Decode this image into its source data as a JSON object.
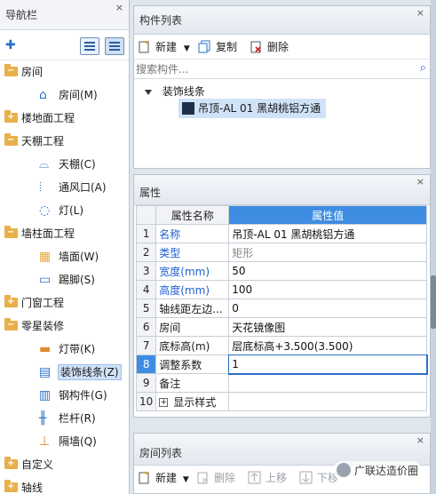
{
  "nav": {
    "title": "导航栏",
    "items": [
      {
        "label": "房间",
        "type": "group",
        "toggle": "−"
      },
      {
        "label": "房间(M)",
        "type": "sub",
        "icon": "house-icon"
      },
      {
        "label": "楼地面工程",
        "type": "group",
        "toggle": "+"
      },
      {
        "label": "天棚工程",
        "type": "group",
        "toggle": "−"
      },
      {
        "label": "天棚(C)",
        "type": "sub",
        "icon": "ceiling-icon"
      },
      {
        "label": "通风口(A)",
        "type": "sub",
        "icon": "vent-icon"
      },
      {
        "label": "灯(L)",
        "type": "sub",
        "icon": "bulb-icon"
      },
      {
        "label": "墙柱面工程",
        "type": "group",
        "toggle": "−"
      },
      {
        "label": "墙面(W)",
        "type": "sub",
        "icon": "wall-icon"
      },
      {
        "label": "踢脚(S)",
        "type": "sub",
        "icon": "skirting-icon"
      },
      {
        "label": "门窗工程",
        "type": "group",
        "toggle": "+"
      },
      {
        "label": "零星装修",
        "type": "group",
        "toggle": "−"
      },
      {
        "label": "灯带(K)",
        "type": "sub",
        "icon": "lightstrip-icon"
      },
      {
        "label": "装饰线条(Z)",
        "type": "sub",
        "icon": "molding-icon",
        "selected": true
      },
      {
        "label": "钢构件(G)",
        "type": "sub",
        "icon": "steel-icon"
      },
      {
        "label": "栏杆(R)",
        "type": "sub",
        "icon": "railing-icon"
      },
      {
        "label": "隔墙(Q)",
        "type": "sub",
        "icon": "partition-icon"
      },
      {
        "label": "自定义",
        "type": "group",
        "toggle": "+"
      },
      {
        "label": "轴线",
        "type": "group",
        "toggle": "+"
      }
    ]
  },
  "components": {
    "title": "构件列表",
    "new_label": "新建",
    "copy_label": "复制",
    "delete_label": "删除",
    "search_placeholder": "搜索构件...",
    "tree_root": "装饰线条",
    "tree_leaf": "吊顶-AL 01 黑胡桃铝方通"
  },
  "properties": {
    "title": "属性",
    "col_name": "属性名称",
    "col_value": "属性值",
    "rows": [
      {
        "n": "1",
        "name": "名称",
        "value": "吊顶-AL 01 黑胡桃铝方通",
        "pub": true
      },
      {
        "n": "2",
        "name": "类型",
        "value": "矩形",
        "pub": true,
        "grey": true
      },
      {
        "n": "3",
        "name": "宽度(mm)",
        "value": "50",
        "pub": true
      },
      {
        "n": "4",
        "name": "高度(mm)",
        "value": "100",
        "pub": true
      },
      {
        "n": "5",
        "name": "轴线距左边...",
        "value": "0"
      },
      {
        "n": "6",
        "name": "房间",
        "value": "天花镜像图"
      },
      {
        "n": "7",
        "name": "底标高(m)",
        "value": "层底标高+3.500(3.500)"
      },
      {
        "n": "8",
        "name": "调整系数",
        "value": "1",
        "current": true
      },
      {
        "n": "9",
        "name": "备注",
        "value": ""
      },
      {
        "n": "10",
        "name": "显示样式",
        "value": "",
        "expand": true
      }
    ]
  },
  "rooms": {
    "title": "房间列表",
    "new_label": "新建",
    "delete_label": "删除",
    "up_label": "上移",
    "down_label": "下移"
  },
  "watermark": "广联达造价圈",
  "colors": {
    "accent": "#3e8de2",
    "link": "#1f5fcf",
    "folder": "#e9b04a"
  }
}
